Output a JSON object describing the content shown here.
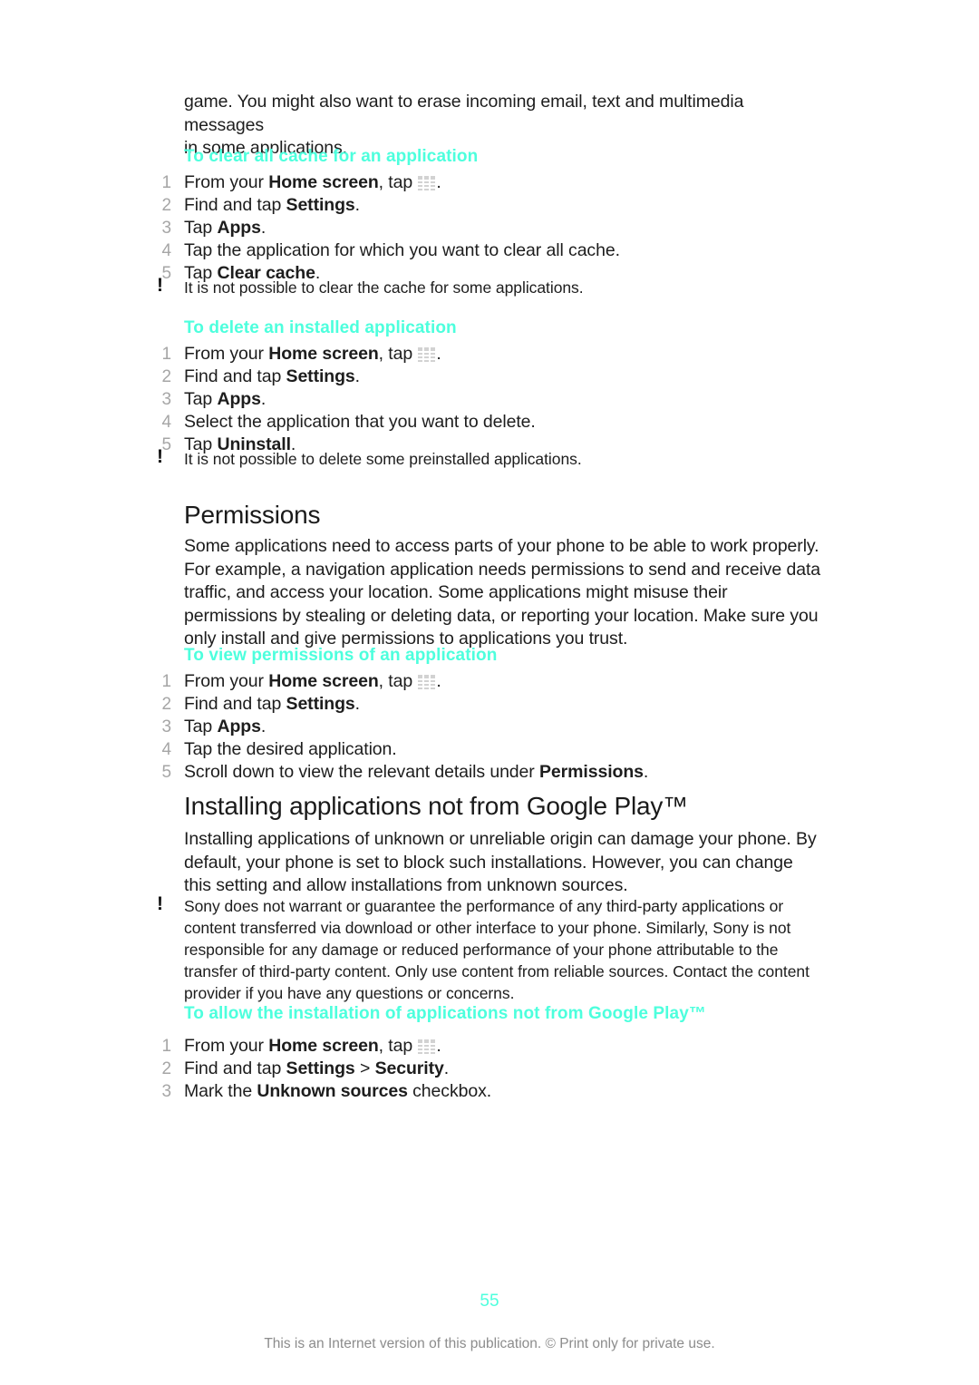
{
  "colors": {
    "heading_cyan": "#4dffdd",
    "body_text": "#1d1d1d",
    "step_number": "#a6a6a6",
    "footer_gray": "#8c8c8c"
  },
  "intro": {
    "line1": "game. You might also want to erase incoming email, text and multimedia messages",
    "line2": "in some applications."
  },
  "proc_clear_cache": {
    "heading": "To clear all cache for an application",
    "steps": [
      {
        "num": "1",
        "pre": "From your ",
        "bold": "Home screen",
        "mid": ", tap ",
        "icon": "app-drawer-icon",
        "post": "."
      },
      {
        "num": "2",
        "pre": "Find and tap ",
        "bold": "Settings",
        "mid": "",
        "post": "."
      },
      {
        "num": "3",
        "pre": "Tap ",
        "bold": "Apps",
        "mid": "",
        "post": "."
      },
      {
        "num": "4",
        "pre": "Tap the application for which you want to clear all cache.",
        "bold": "",
        "mid": "",
        "post": ""
      },
      {
        "num": "5",
        "pre": "Tap ",
        "bold": "Clear cache",
        "mid": "",
        "post": "."
      }
    ],
    "note": "It is not possible to clear the cache for some applications."
  },
  "proc_delete_app": {
    "heading": "To delete an installed application",
    "steps": [
      {
        "num": "1",
        "pre": "From your ",
        "bold": "Home screen",
        "mid": ", tap ",
        "icon": "app-drawer-icon",
        "post": "."
      },
      {
        "num": "2",
        "pre": "Find and tap ",
        "bold": "Settings",
        "mid": "",
        "post": "."
      },
      {
        "num": "3",
        "pre": "Tap ",
        "bold": "Apps",
        "mid": "",
        "post": "."
      },
      {
        "num": "4",
        "pre": "Select the application that you want to delete.",
        "bold": "",
        "mid": "",
        "post": ""
      },
      {
        "num": "5",
        "pre": "Tap ",
        "bold": "Uninstall",
        "mid": "",
        "post": "."
      }
    ],
    "note": "It is not possible to delete some preinstalled applications."
  },
  "permissions": {
    "title": "Permissions",
    "body": "Some applications need to access parts of your phone to be able to work properly. For example, a navigation application needs permissions to send and receive data traffic, and access your location. Some applications might misuse their permissions by stealing or deleting data, or reporting your location. Make sure you only install and give permissions to applications you trust."
  },
  "proc_view_permissions": {
    "heading": "To view permissions of an application",
    "steps": [
      {
        "num": "1",
        "pre": "From your ",
        "bold": "Home screen",
        "mid": ", tap ",
        "icon": "app-drawer-icon",
        "post": "."
      },
      {
        "num": "2",
        "pre": "Find and tap ",
        "bold": "Settings",
        "mid": "",
        "post": "."
      },
      {
        "num": "3",
        "pre": "Tap ",
        "bold": "Apps",
        "mid": "",
        "post": "."
      },
      {
        "num": "4",
        "pre": "Tap the desired application.",
        "bold": "",
        "mid": "",
        "post": ""
      },
      {
        "num": "5",
        "pre": "Scroll down to view the relevant details under ",
        "bold": "Permissions",
        "mid": "",
        "post": "."
      }
    ]
  },
  "installing": {
    "title": "Installing applications not from Google Play™",
    "body": "Installing applications of unknown or unreliable origin can damage your phone. By default, your phone is set to block such installations. However, you can change this setting and allow installations from unknown sources.",
    "note": "Sony does not warrant or guarantee the performance of any third-party applications or content transferred via download or other interface to your phone. Similarly, Sony is not responsible for any damage or reduced performance of your phone attributable to the transfer of third-party content. Only use content from reliable sources. Contact the content provider if you have any questions or concerns."
  },
  "proc_allow_install": {
    "heading": "To allow the installation of applications not from Google Play™",
    "steps": [
      {
        "num": "1",
        "pre": "From your ",
        "bold": "Home screen",
        "mid": ", tap ",
        "icon": "app-drawer-icon",
        "post": "."
      },
      {
        "num": "2",
        "pre": "Find and tap ",
        "bold": "Settings",
        "mid": " > ",
        "bold2": "Security",
        "post": "."
      },
      {
        "num": "3",
        "pre": "Mark the ",
        "bold": "Unknown sources",
        "mid": " checkbox",
        "post": "."
      }
    ]
  },
  "footer": {
    "page_number": "55",
    "notice": "This is an Internet version of this publication. © Print only for private use."
  }
}
